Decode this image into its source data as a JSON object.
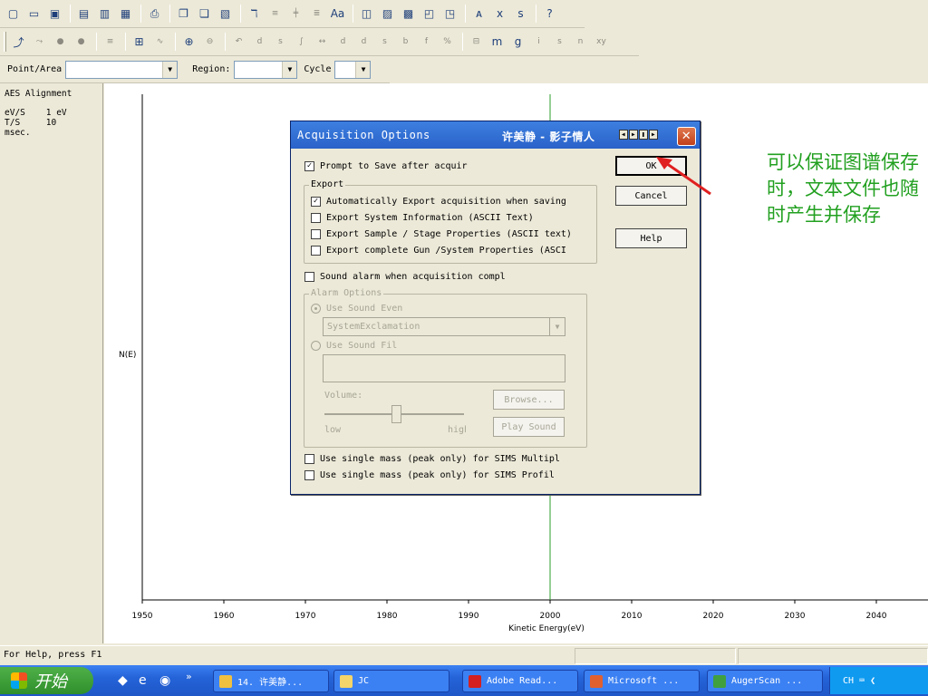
{
  "toolbar3": {
    "point_area_label": "Point/Area",
    "point_area_value": "",
    "region_label": "Region:",
    "region_value": "",
    "cycle_label": "Cycle",
    "cycle_value": ""
  },
  "left_panel": {
    "title": "AES Alignment",
    "line1": "eV/S    1 eV",
    "line2": "T/S     10",
    "line3": "msec."
  },
  "chart_data": {
    "type": "line",
    "xlabel": "Kinetic Energy(eV)",
    "ylabel": "N(E)",
    "xlim": [
      1950,
      2040
    ],
    "x_ticks": [
      1950,
      1960,
      1970,
      1980,
      1990,
      2000,
      2010,
      2020,
      2030,
      2040
    ],
    "series": [
      {
        "x": [
          2000,
          2000
        ],
        "y": [
          0,
          1
        ]
      }
    ]
  },
  "dialog": {
    "title": "Acquisition Options",
    "title_extra": "许美静 - 影子情人",
    "prompt_save": "Prompt to Save after acquir",
    "export_group": "Export",
    "auto_export": "Automatically Export acquisition when saving",
    "export_system": "Export System Information (ASCII Text)",
    "export_sample": "Export Sample / Stage Properties (ASCII text)",
    "export_gun": "Export complete Gun /System Properties (ASCI",
    "sound_alarm": "Sound alarm when acquisition compl",
    "alarm_group": "Alarm Options",
    "use_sound_event": "Use Sound Even",
    "sound_event_value": "SystemExclamation",
    "use_sound_file": "Use Sound Fil",
    "volume_label": "Volume:",
    "volume_low": "low",
    "volume_high": "high",
    "browse": "Browse...",
    "play_sound": "Play Sound",
    "single_mass_multi": "Use single mass (peak only) for SIMS Multipl",
    "single_mass_profile": "Use single mass (peak only) for SIMS Profil",
    "ok": "OK",
    "cancel": "Cancel",
    "help": "Help",
    "volume_level": 0.52
  },
  "annotation": {
    "text": "可以保证图谱保存时，文本文件也随时产生并保存"
  },
  "status": {
    "text": "For Help, press F1"
  },
  "taskbar": {
    "start": "开始",
    "tasks": [
      "14. 许美静...",
      "JC",
      "Adobe Read...",
      "Microsoft ...",
      "AugerScan ..."
    ],
    "tray_lang": "CH"
  },
  "colors": {
    "annotation": "#22a020",
    "arrow": "#e02020",
    "titlebar": "#2a62c9"
  }
}
